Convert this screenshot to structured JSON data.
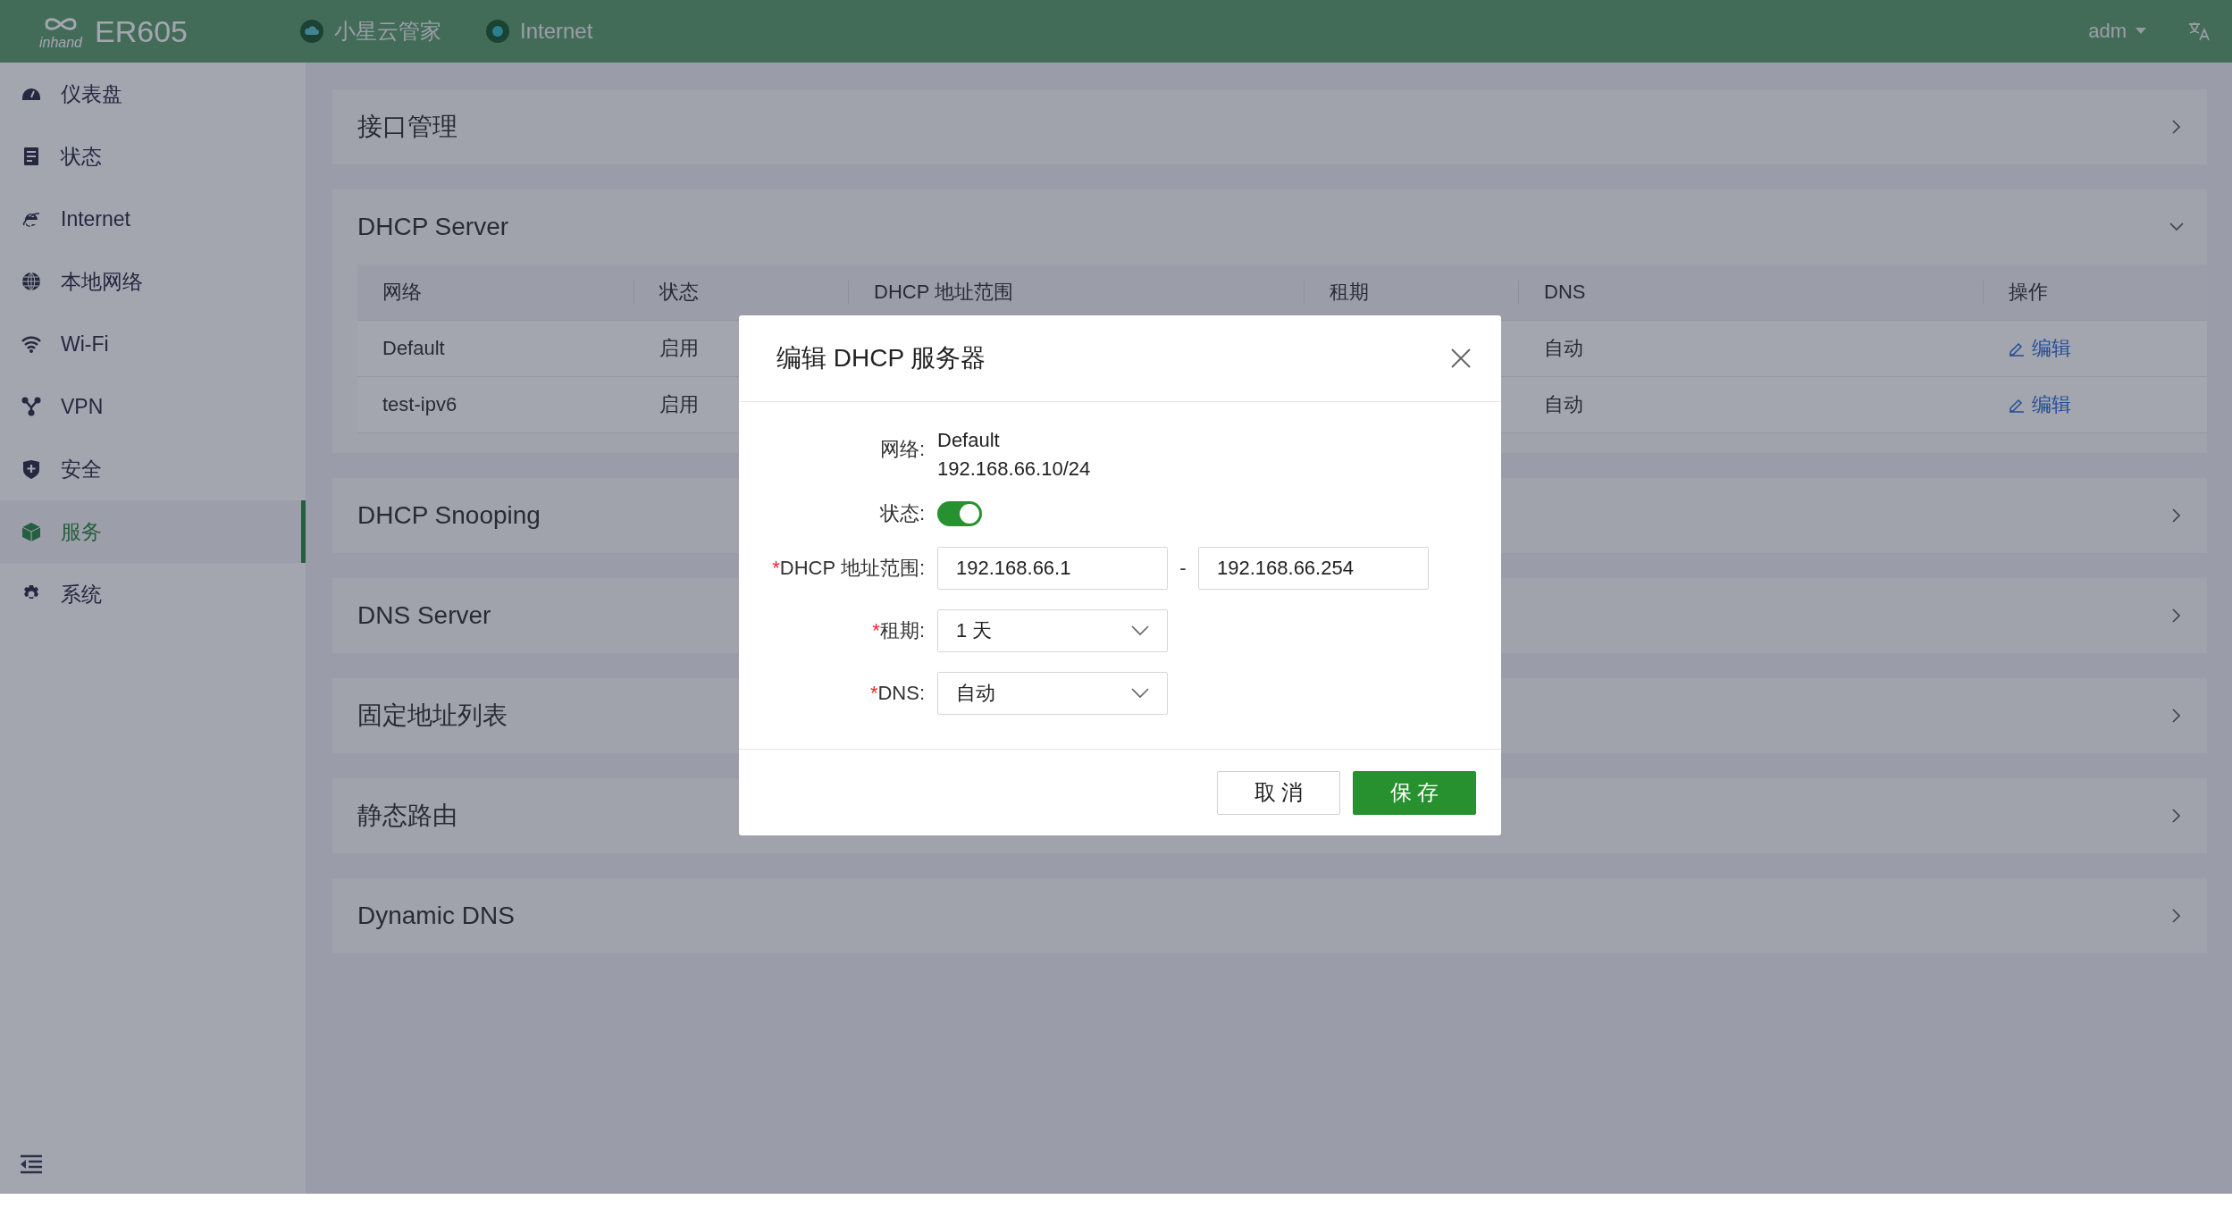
{
  "top_bar": {
    "logo_text": "inhand",
    "product": "ER605",
    "links": [
      {
        "label": "小星云管家",
        "kind": "cloud"
      },
      {
        "label": "Internet",
        "kind": "dot"
      }
    ],
    "user": "adm"
  },
  "sidebar": {
    "items": [
      {
        "label": "仪表盘",
        "selected": false
      },
      {
        "label": "状态",
        "selected": false
      },
      {
        "label": "Internet",
        "selected": false
      },
      {
        "label": "本地网络",
        "selected": false
      },
      {
        "label": "Wi-Fi",
        "selected": false
      },
      {
        "label": "VPN",
        "selected": false
      },
      {
        "label": "安全",
        "selected": false
      },
      {
        "label": "服务",
        "selected": true
      },
      {
        "label": "系统",
        "selected": false
      }
    ]
  },
  "panels": [
    {
      "title": "接口管理",
      "expanded": false
    },
    {
      "title": "DHCP Server",
      "expanded": true,
      "table": {
        "columns": [
          "网络",
          "状态",
          "DHCP 地址范围",
          "租期",
          "DNS",
          "操作"
        ],
        "rows": [
          {
            "network": "Default",
            "status": "启用",
            "dns": "自动",
            "action": "编辑"
          },
          {
            "network": "test-ipv6",
            "status": "启用",
            "dns": "自动",
            "action": "编辑"
          }
        ]
      }
    },
    {
      "title": "DHCP Snooping",
      "expanded": false
    },
    {
      "title": "DNS Server",
      "expanded": false
    },
    {
      "title": "固定地址列表",
      "expanded": false
    },
    {
      "title": "静态路由",
      "expanded": false
    },
    {
      "title": "Dynamic DNS",
      "expanded": false
    }
  ],
  "dialog": {
    "title": "编辑 DHCP 服务器",
    "fields": [
      {
        "kind": "text",
        "label": "网络:",
        "lines": [
          "Default",
          "192.168.66.10/24"
        ]
      },
      {
        "kind": "switch",
        "label": "状态:",
        "on": true
      },
      {
        "kind": "range",
        "required_mark": "*",
        "label": "DHCP 地址范围:",
        "from": "192.168.66.1",
        "separator": "-",
        "to": "192.168.66.254"
      },
      {
        "kind": "select",
        "required_mark": "*",
        "label": "租期:",
        "value": "1 天"
      },
      {
        "kind": "select",
        "required_mark": "*",
        "label": "DNS:",
        "value": "自动"
      }
    ],
    "buttons": [
      {
        "label": "取 消",
        "kind": "default"
      },
      {
        "label": "保 存",
        "kind": "primary"
      }
    ]
  }
}
